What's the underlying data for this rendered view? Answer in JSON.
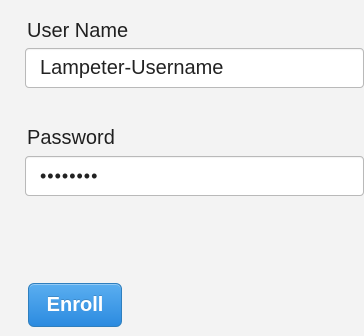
{
  "form": {
    "username": {
      "label": "User Name",
      "value": "Lampeter-Username"
    },
    "password": {
      "label": "Password",
      "value": "••••••••"
    },
    "submit_label": "Enroll"
  },
  "colors": {
    "background": "#f3f3f3",
    "button_top": "#5aaef0",
    "button_bottom": "#2c8be0",
    "button_text": "#ffffff"
  }
}
